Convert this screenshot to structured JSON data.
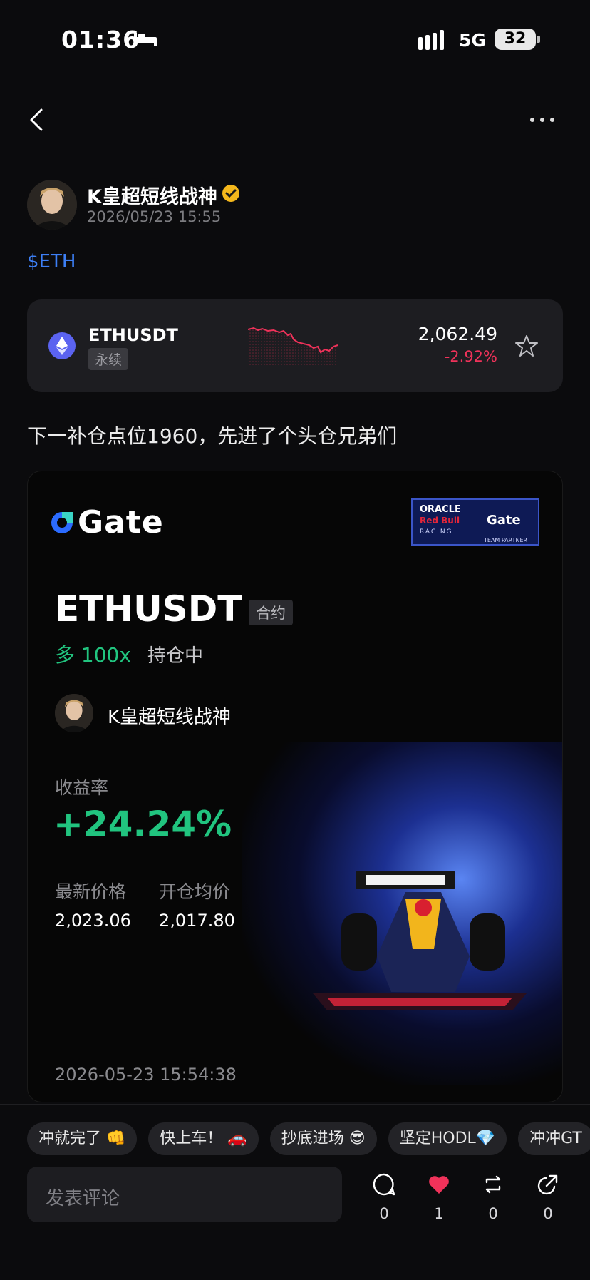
{
  "status_bar": {
    "time": "01:36",
    "network": "5G",
    "battery": "32"
  },
  "author": {
    "name": "K皇超短线战神",
    "timestamp": "2026/05/23 15:55"
  },
  "post": {
    "tag": "$ETH",
    "text": "下一补仓点位1960，先进了个头仓兄弟们"
  },
  "ticker": {
    "symbol": "ETHUSDT",
    "type": "永续",
    "price": "2,062.49",
    "change": "-2.92%"
  },
  "share_card": {
    "brand": "Gate",
    "partner": {
      "oracle": "ORACLE",
      "redbull": "Red Bull",
      "racing": "RACING",
      "gate": "Gate",
      "team": "TEAM PARTNER"
    },
    "symbol": "ETHUSDT",
    "contract_label": "合约",
    "position": "多 100x",
    "status": "持仓中",
    "user": "K皇超短线战神",
    "roi_label": "收益率",
    "roi": "+24.24%",
    "last_price_label": "最新价格",
    "avg_price_label": "开仓均价",
    "last_price": "2,023.06",
    "avg_price": "2,017.80",
    "time": "2026-05-23 15:54:38"
  },
  "quick_comments": [
    "冲就完了 👊",
    "快上车！ 🚗",
    "抄底进场 😎",
    "坚定HODL💎",
    "冲冲GT"
  ],
  "comment_placeholder": "发表评论",
  "actions": {
    "comments": "0",
    "likes": "1",
    "reposts": "0",
    "shares": "0"
  },
  "colors": {
    "accent": "#3d7ff5",
    "up": "#21c47f",
    "down": "#f0325a",
    "background": "#0b0b0d"
  }
}
